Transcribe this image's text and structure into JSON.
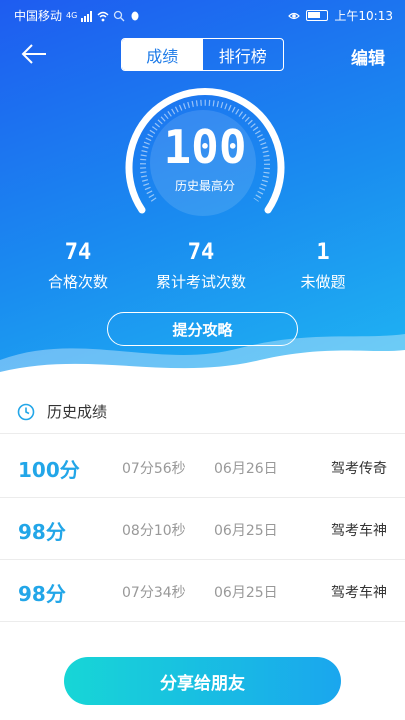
{
  "status_bar": {
    "carrier": "中国移动",
    "network": "4G",
    "time": "上午10:13"
  },
  "header": {
    "tabs": [
      {
        "label": "成绩",
        "active": true
      },
      {
        "label": "排行榜",
        "active": false
      }
    ],
    "edit_label": "编辑"
  },
  "score": {
    "value": "100",
    "label": "历史最高分"
  },
  "stats": [
    {
      "value": "74",
      "label": "合格次数"
    },
    {
      "value": "74",
      "label": "累计考试次数"
    },
    {
      "value": "1",
      "label": "未做题"
    }
  ],
  "tips_button": "提分攻略",
  "history": {
    "title": "历史成绩",
    "rows": [
      {
        "score": "100分",
        "duration": "07分56秒",
        "date": "06月26日",
        "title": "驾考传奇"
      },
      {
        "score": "98分",
        "duration": "08分10秒",
        "date": "06月25日",
        "title": "驾考车神"
      },
      {
        "score": "98分",
        "duration": "07分34秒",
        "date": "06月25日",
        "title": "驾考车神"
      }
    ]
  },
  "share_button": "分享给朋友",
  "colors": {
    "hero_top": "#1e5cf0",
    "hero_bottom": "#1fb6f2",
    "score_text": "#22a6e8",
    "share_start": "#17d6d6",
    "share_end": "#1aa6ee"
  },
  "icons": [
    "back-arrow-icon",
    "clock-icon",
    "wifi-icon",
    "eye-icon",
    "battery-icon",
    "search-icon",
    "qq-icon"
  ]
}
